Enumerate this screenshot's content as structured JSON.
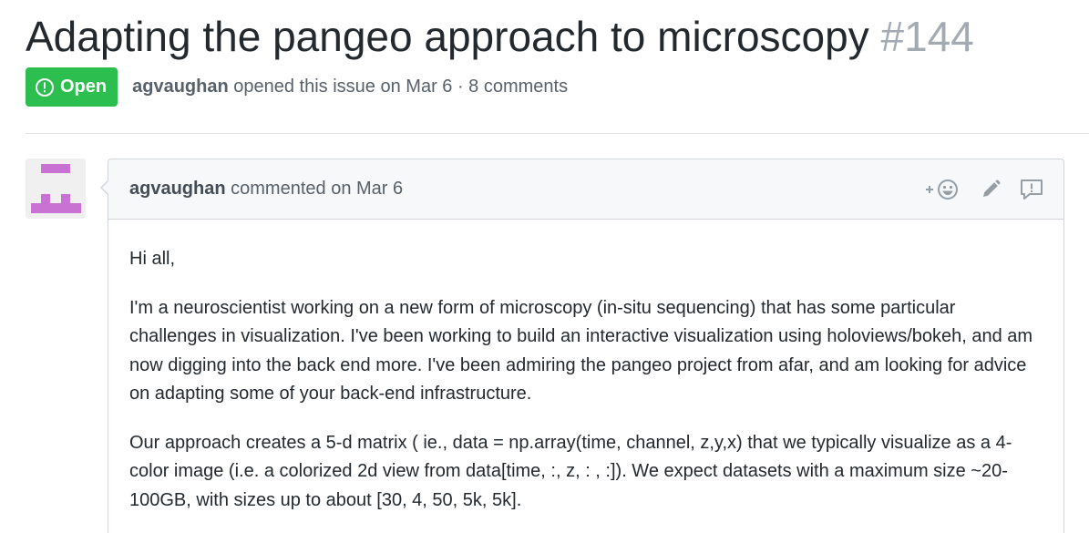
{
  "issue": {
    "title": "Adapting the pangeo approach to microscopy",
    "number": "#144",
    "state": "Open",
    "author": "agvaughan",
    "opened_text": "opened this issue on Mar 6 · 8 comments"
  },
  "comment": {
    "author": "agvaughan",
    "commented_text": "commented on Mar 6",
    "paragraphs": [
      "Hi all,",
      "I'm a neuroscientist working on a new form of microscopy (in-situ sequencing) that has some particular challenges in visualization. I've been working to build an interactive visualization using holoviews/bokeh, and am now digging into the back end more. I've been admiring the pangeo project from afar, and am looking for advice on adapting some of your back-end infrastructure.",
      "Our approach creates a 5-d matrix ( ie., data = np.array(time, channel, z,y,x) that we typically visualize as a 4-color image (i.e. a colorized 2d view from data[time, :, z, : , :]). We expect datasets with a maximum size ~20-100GB, with sizes up to about [30, 4, 50, 5k, 5k]."
    ]
  },
  "icons": {
    "state": "issue-opened-icon",
    "reaction": "add-reaction-icon",
    "edit": "pencil-icon",
    "report": "report-icon"
  },
  "colors": {
    "open_green": "#2cbe4e",
    "avatar_purple": "#c972d4",
    "muted_text": "#586069"
  }
}
